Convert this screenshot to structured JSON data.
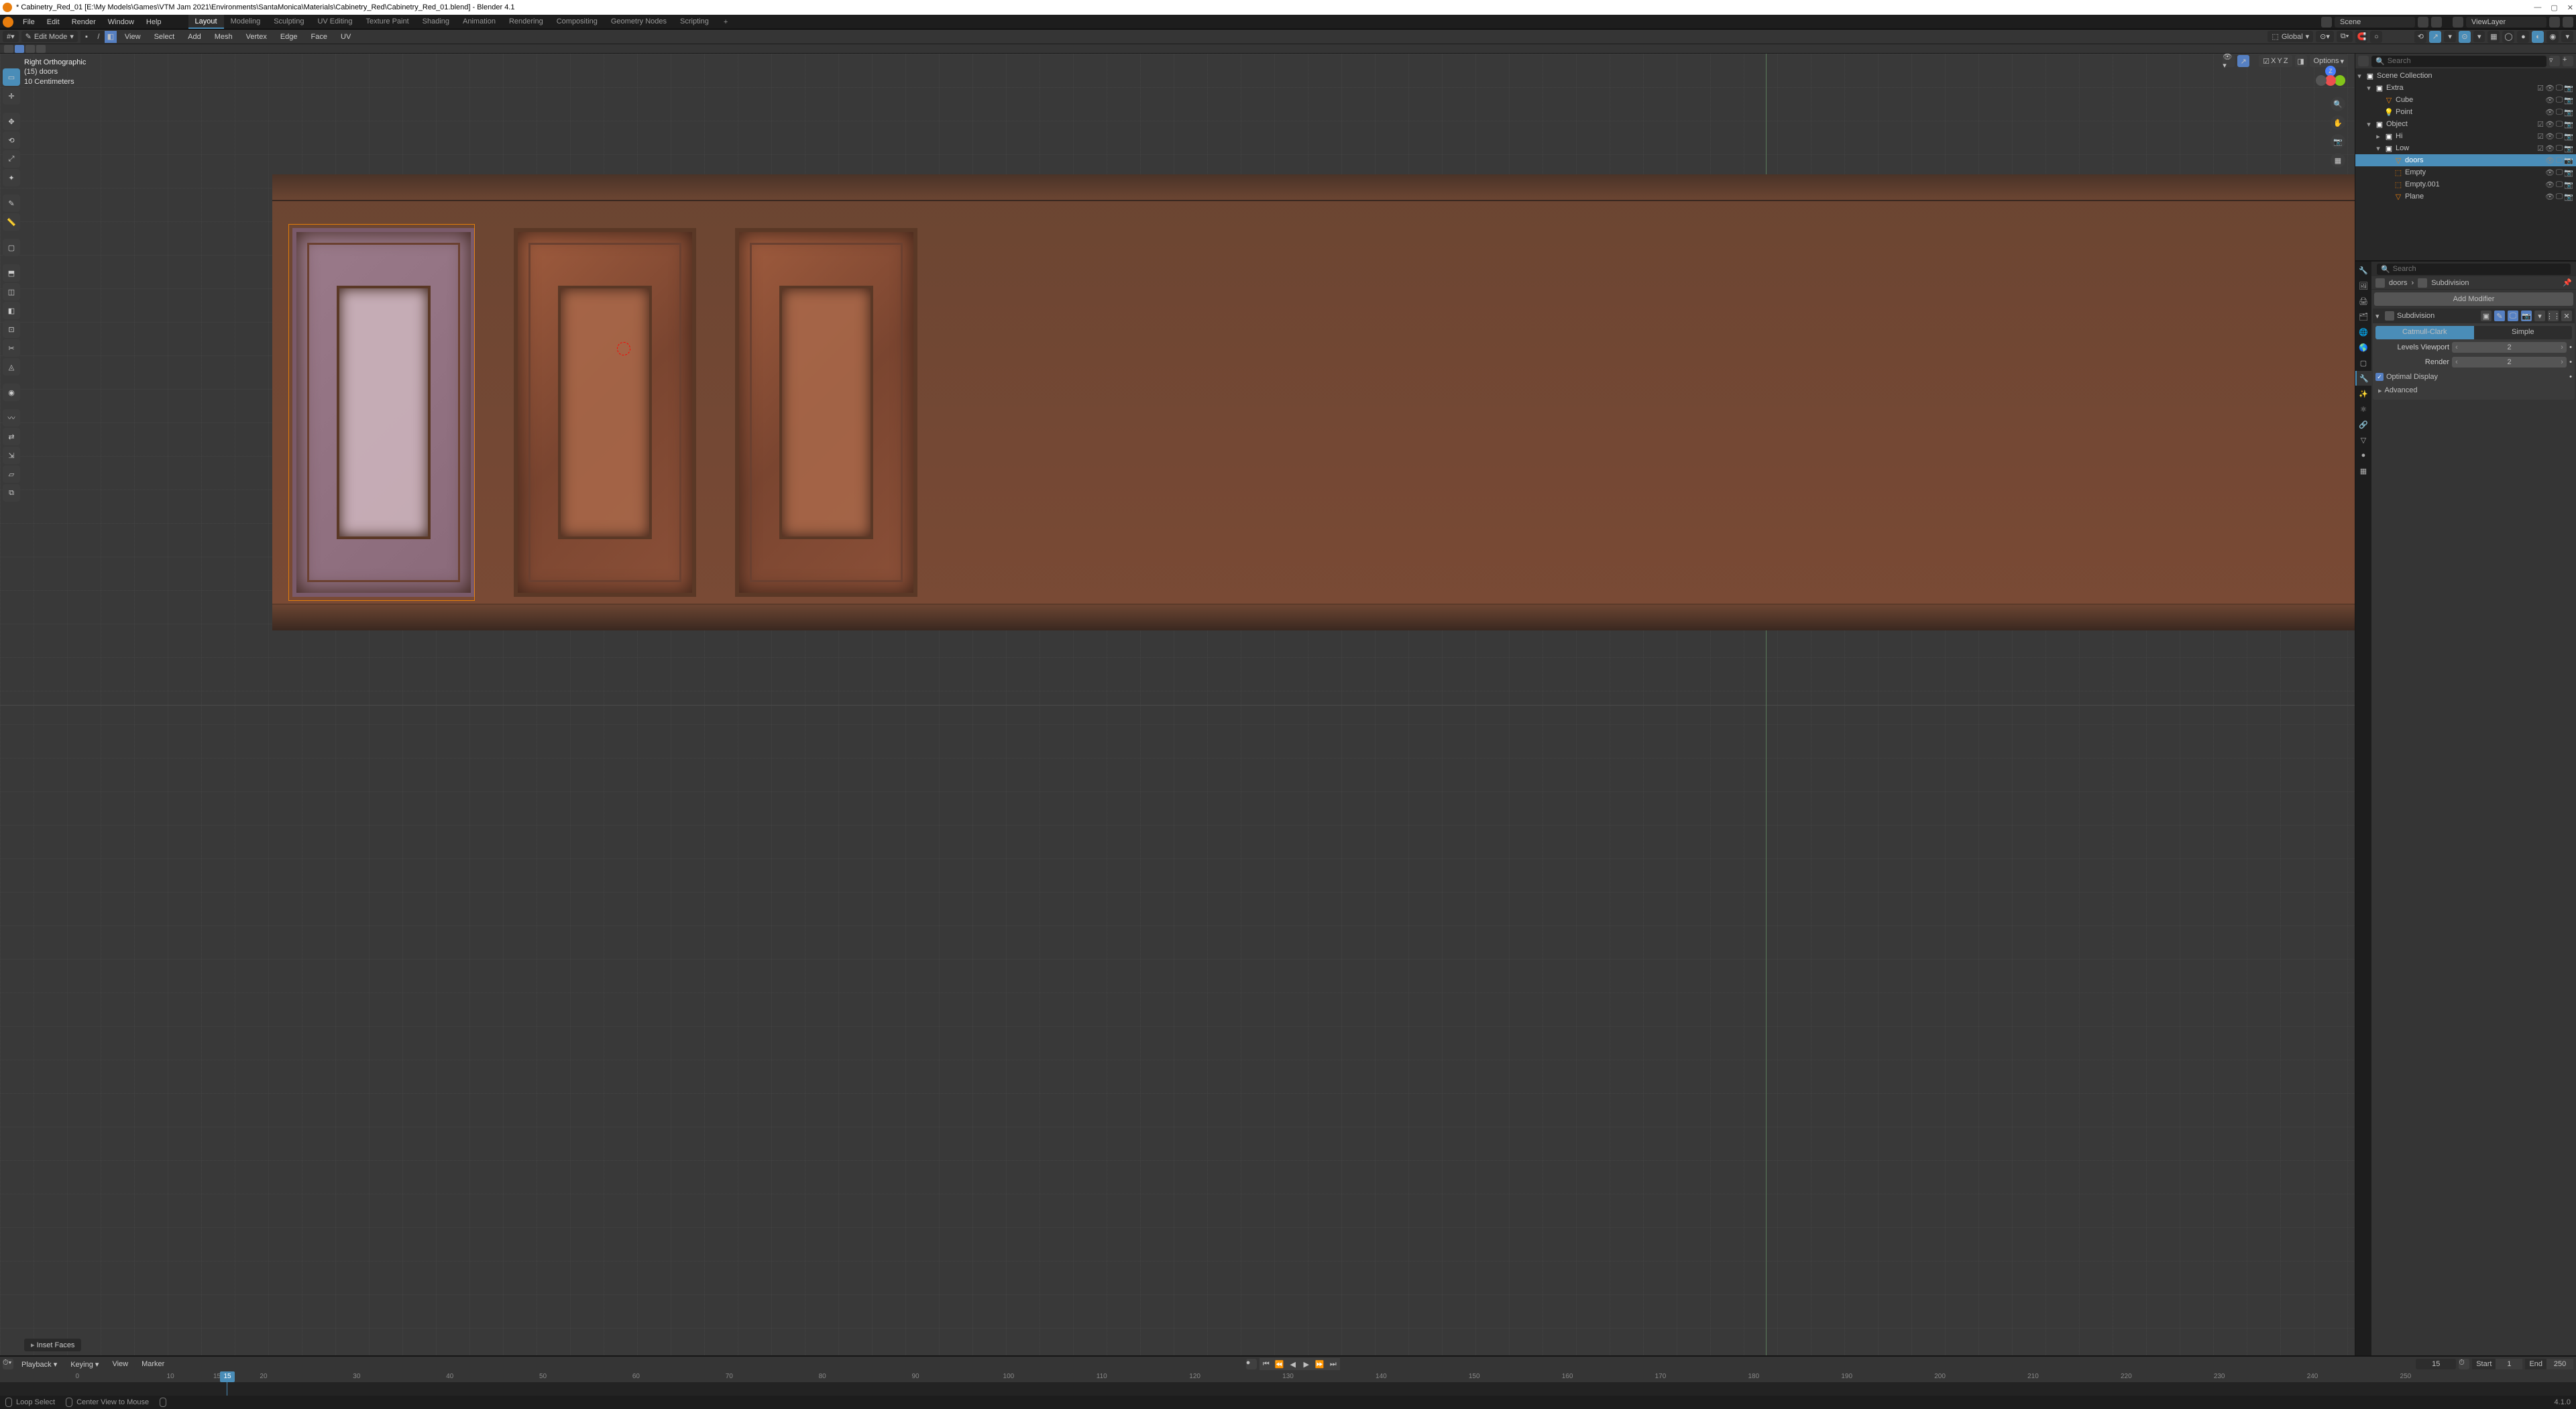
{
  "titlebar": {
    "title": "* Cabinetry_Red_01 [E:\\My Models\\Games\\VTM Jam 2021\\Environments\\SantaMonica\\Materials\\Cabinetry_Red\\Cabinetry_Red_01.blend] - Blender 4.1"
  },
  "topmenu": {
    "file": "File",
    "edit": "Edit",
    "render": "Render",
    "window": "Window",
    "help": "Help",
    "scene_label": "Scene",
    "viewlayer_label": "ViewLayer"
  },
  "workspaces": {
    "tabs": [
      "Layout",
      "Modeling",
      "Sculpting",
      "UV Editing",
      "Texture Paint",
      "Shading",
      "Animation",
      "Rendering",
      "Compositing",
      "Geometry Nodes",
      "Scripting"
    ],
    "active": 0
  },
  "toolbar": {
    "mode": "Edit Mode",
    "view": "View",
    "select": "Select",
    "add": "Add",
    "mesh": "Mesh",
    "vertex": "Vertex",
    "edge": "Edge",
    "face": "Face",
    "uv": "UV",
    "orient": "Global"
  },
  "viewport": {
    "overlay_l1": "Right Orthographic",
    "overlay_l2": "(15) doors",
    "overlay_l3": "10 Centimeters",
    "options": "Options",
    "x": "X",
    "y": "Y",
    "z": "Z"
  },
  "inset_panel": "Inset Faces",
  "outliner": {
    "search_ph": "Search",
    "root": "Scene Collection",
    "items": [
      {
        "label": "Extra",
        "depth": 1,
        "type": "coll",
        "open": true
      },
      {
        "label": "Cube",
        "depth": 2,
        "type": "mesh"
      },
      {
        "label": "Point",
        "depth": 2,
        "type": "light"
      },
      {
        "label": "Object",
        "depth": 1,
        "type": "coll",
        "open": true
      },
      {
        "label": "Hi",
        "depth": 2,
        "type": "coll"
      },
      {
        "label": "Low",
        "depth": 2,
        "type": "coll",
        "open": true
      },
      {
        "label": "doors",
        "depth": 3,
        "type": "mesh",
        "selected": true
      },
      {
        "label": "Empty",
        "depth": 3,
        "type": "empty"
      },
      {
        "label": "Empty.001",
        "depth": 3,
        "type": "empty"
      },
      {
        "label": "Plane",
        "depth": 3,
        "type": "mesh"
      }
    ]
  },
  "properties": {
    "search_ph": "Search",
    "crumb_obj": "doors",
    "crumb_mod": "Subdivision",
    "add_mod": "Add Modifier",
    "mod": {
      "name": "Subdivision",
      "type_a": "Catmull-Clark",
      "type_b": "Simple",
      "levels_lbl": "Levels Viewport",
      "levels_val": "2",
      "render_lbl": "Render",
      "render_val": "2",
      "optimal": "Optimal Display",
      "advanced": "Advanced"
    }
  },
  "timeline": {
    "playback": "Playback",
    "keying": "Keying",
    "view": "View",
    "marker": "Marker",
    "current": "15",
    "start_lbl": "Start",
    "start": "1",
    "end_lbl": "End",
    "end": "250",
    "ticks": [
      0,
      10,
      15,
      20,
      30,
      40,
      50,
      60,
      70,
      80,
      90,
      100,
      110,
      120,
      130,
      140,
      150,
      160,
      170,
      180,
      190,
      200,
      210,
      220,
      230,
      240,
      250
    ]
  },
  "status": {
    "loop": "Loop Select",
    "center": "Center View to Mouse",
    "version": "4.1.0"
  }
}
